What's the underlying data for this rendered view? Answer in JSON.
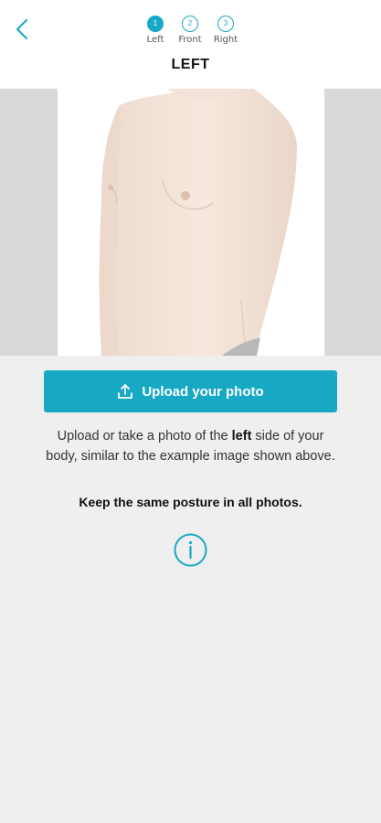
{
  "header": {
    "steps": [
      {
        "number": "1",
        "label": "Left",
        "active": true
      },
      {
        "number": "2",
        "label": "Front",
        "active": false
      },
      {
        "number": "3",
        "label": "Right",
        "active": false
      }
    ],
    "title": "LEFT"
  },
  "upload_button": {
    "label": "Upload your photo"
  },
  "instructions": {
    "prefix": "Upload or take a photo of the ",
    "emphasis": "left",
    "suffix": " side of your body, similar to the example image shown above.",
    "note": "Keep the same posture in all photos."
  },
  "colors": {
    "accent": "#17a8c4",
    "background": "#efefef"
  },
  "icons": {
    "back": "chevron-left-icon",
    "upload": "upload-icon",
    "info": "info-icon"
  }
}
